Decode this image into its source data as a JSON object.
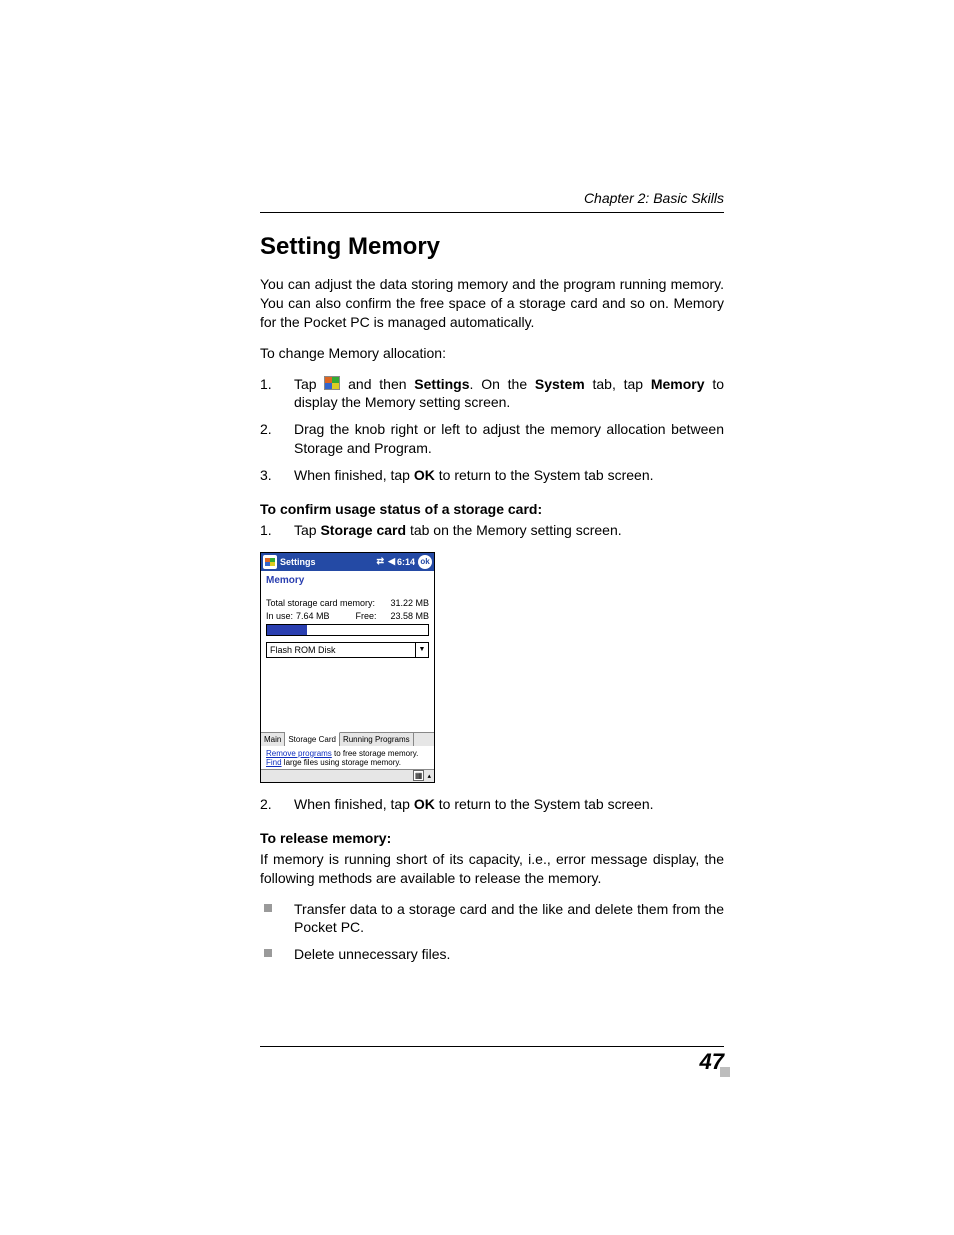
{
  "header": {
    "chapter": "Chapter 2: Basic Skills"
  },
  "h1": "Setting Memory",
  "intro": "You can adjust the data storing memory and the program running memory. You can also confirm the free space of a storage card and so on. Memory for the Pocket PC is managed automatically.",
  "lead1": "To change Memory allocation:",
  "steps1": {
    "s1a": "Tap ",
    "s1b": " and then ",
    "s1c": "Settings",
    "s1d": ". On the ",
    "s1e": "System",
    "s1f": " tab, tap ",
    "s1g": "Memory",
    "s1h": " to display the Memory setting screen.",
    "s2": "Drag the knob right or left to adjust the memory allocation between Storage and Program.",
    "s3a": "When finished, tap ",
    "s3b": "OK",
    "s3c": " to return to the System tab screen."
  },
  "sub1": "To confirm usage status of a storage card:",
  "steps2": {
    "s1a": "Tap ",
    "s1b": "Storage card",
    "s1c": " tab on the Memory setting screen.",
    "s2a": "When finished, tap ",
    "s2b": "OK",
    "s2c": " to return to the System tab screen."
  },
  "screenshot": {
    "title": "Settings",
    "time": "6:14",
    "ok": "ok",
    "subtitle": "Memory",
    "total_label": "Total storage card memory:",
    "total_val": "31.22 MB",
    "inuse_label": "In use:",
    "inuse_val": "7.64 MB",
    "free_label": "Free:",
    "free_val": "23.58 MB",
    "dropdown": "Flash ROM Disk",
    "tabs": {
      "t1": "Main",
      "t2": "Storage Card",
      "t3": "Running Programs"
    },
    "footer_link1": "Remove programs",
    "footer_text1": " to free storage memory.",
    "footer_link2": "Find",
    "footer_text2": " large files using storage memory."
  },
  "sub2": "To release memory:",
  "para2": "If memory is running short of its capacity, i.e., error message display, the following methods are available to release the memory.",
  "bullets": {
    "b1": "Transfer data to a storage card and the like and delete them from the Pocket PC.",
    "b2": "Delete unnecessary files."
  },
  "page_num": "47"
}
